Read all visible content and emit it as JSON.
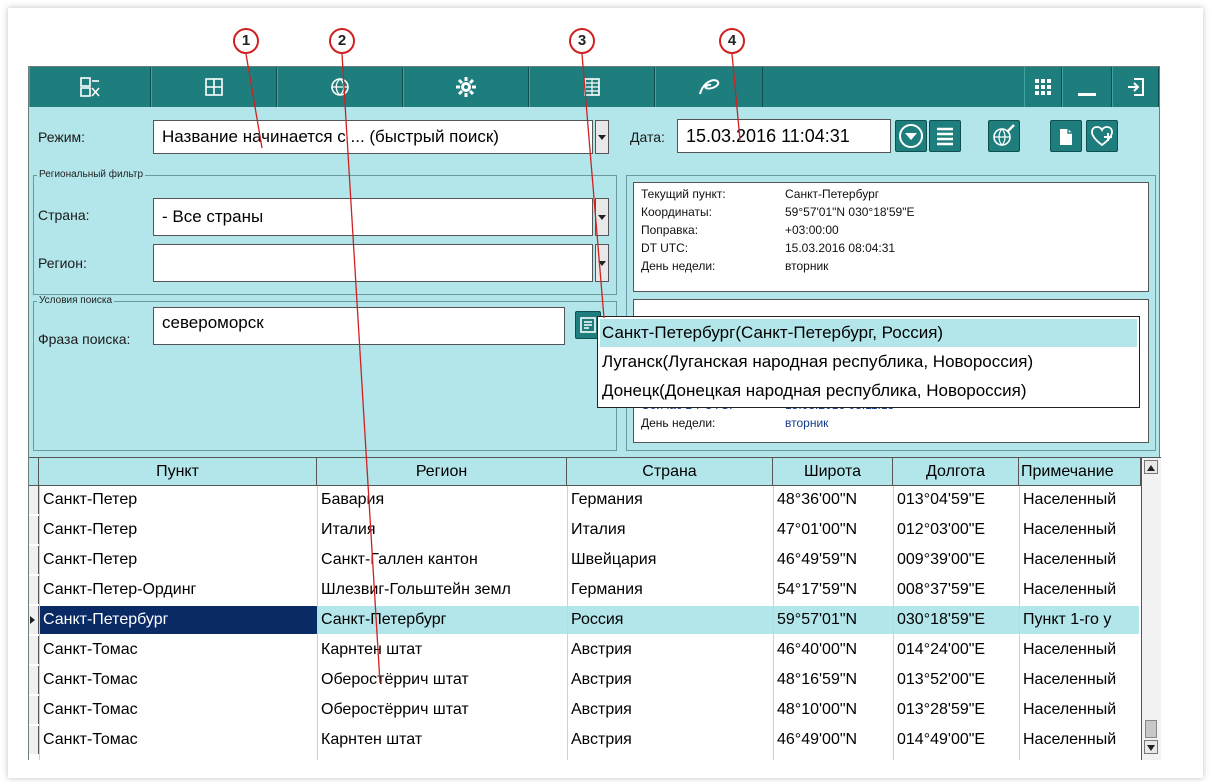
{
  "annotations": [
    "1",
    "2",
    "3",
    "4"
  ],
  "toolbar": {
    "icons": [
      "calculator-icon",
      "grid-icon",
      "globe-icon",
      "gear-icon",
      "table-icon",
      "ephemeris-icon"
    ],
    "right_icons": [
      "apps-icon",
      "minimize-icon",
      "exit-icon"
    ]
  },
  "mode": {
    "label": "Режим:",
    "value": "Название начинается с ... (быстрый поиск)"
  },
  "date": {
    "label": "Дата:",
    "value": "15.03.2016 11:04:31"
  },
  "regional_filter": {
    "title": "Региональный фильтр",
    "country_label": "Страна:",
    "country_value": "- Все страны",
    "region_label": "Регион:",
    "region_value": ""
  },
  "search_conditions": {
    "title": "Условия поиска",
    "phrase_label": "Фраза поиска:",
    "phrase_value": "североморск"
  },
  "current_point": {
    "rows": [
      {
        "k": "Текущий пункт:",
        "v": "Санкт-Петербург"
      },
      {
        "k": "Координаты:",
        "v": "59°57'01\"N   030°18'59\"E"
      },
      {
        "k": "Поправка:",
        "v": "+03:00:00"
      },
      {
        "k": "DT UTC:",
        "v": "15.03.2016 08:04:31"
      },
      {
        "k": "День недели:",
        "v": "вторник"
      }
    ]
  },
  "local_point": {
    "rows": [
      {
        "k": "Сейчас DT UTC:",
        "v": "15.03.2016 08:11:18"
      },
      {
        "k": "День недели:",
        "v": "вторник"
      }
    ]
  },
  "popup": {
    "items": [
      "Санкт-Петербург(Санкт-Петербург, Россия)",
      "Луганск(Луганская народная республика, Новороссия)",
      "Донецк(Донецкая народная республика, Новороссия)"
    ]
  },
  "grid": {
    "headers": [
      "Пункт",
      "Регион",
      "Страна",
      "Широта",
      "Долгота",
      "Примечание"
    ],
    "rows": [
      [
        "Санкт-Петер",
        "Бавария",
        "Германия",
        "48°36'00\"N",
        "013°04'59\"E",
        "Населенный"
      ],
      [
        "Санкт-Петер",
        "Италия",
        "Италия",
        "47°01'00\"N",
        "012°03'00\"E",
        "Населенный"
      ],
      [
        "Санкт-Петер",
        "Санкт-Галлен кантон",
        "Швейцария",
        "46°49'59\"N",
        "009°39'00\"E",
        "Населенный"
      ],
      [
        "Санкт-Петер-Ординг",
        "Шлезвиг-Гольштейн земл",
        "Германия",
        "54°17'59\"N",
        "008°37'59\"E",
        "Населенный"
      ],
      [
        "Санкт-Петербург",
        "Санкт-Петербург",
        "Россия",
        "59°57'01\"N",
        "030°18'59\"E",
        "Пункт 1-го у"
      ],
      [
        "Санкт-Томас",
        "Карнтен штат",
        "Австрия",
        "46°40'00\"N",
        "014°24'00\"E",
        "Населенный"
      ],
      [
        "Санкт-Томас",
        "Оберостёррич штат",
        "Австрия",
        "48°16'59\"N",
        "013°52'00\"E",
        "Населенный"
      ],
      [
        "Санкт-Томас",
        "Оберостёррич штат",
        "Австрия",
        "48°10'00\"N",
        "013°28'59\"E",
        "Населенный"
      ],
      [
        "Санкт-Томас",
        "Карнтен штат",
        "Австрия",
        "46°49'00\"N",
        "014°49'00\"E",
        "Населенный"
      ]
    ],
    "selected_row": 4
  },
  "colors": {
    "toolbar": "#1e7e7d",
    "panel": "#b3e6ea",
    "selection": "#0a2a66",
    "annotation": "#d02020"
  }
}
